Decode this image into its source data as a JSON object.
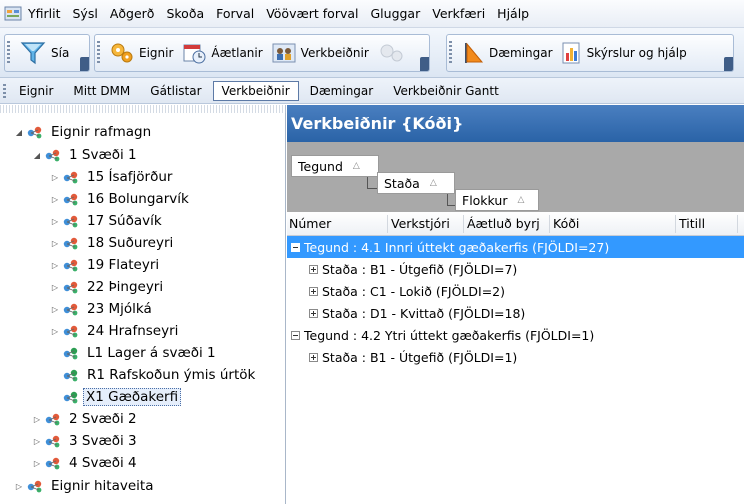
{
  "menubar": {
    "items": [
      "Yfirlit",
      "Sýsl",
      "Aðgerð",
      "Skoða",
      "Forval",
      "Vöövært forval",
      "Gluggar",
      "Verkfæri",
      "Hjálp"
    ]
  },
  "toolbar": {
    "sia": "Sía",
    "eignir": "Eignir",
    "aetlanir": "Áætlanir",
    "verkbeidnir": "Verkbeiðnir",
    "daemingar": "Dæmingar",
    "skyrslur": "Skýrslur og hjálp"
  },
  "subbar": {
    "tabs": [
      "Eignir",
      "Mitt DMM",
      "Gátlistar",
      "Verkbeiðnir",
      "Dæmingar",
      "Verkbeiðnir Gantt"
    ],
    "active": "Verkbeiðnir"
  },
  "tree": {
    "items": [
      {
        "label": "Eignir rafmagn",
        "toggle": "◢"
      },
      {
        "label": "1 Svæði 1",
        "toggle": "◢"
      },
      {
        "label": "15 Ísafjörður",
        "toggle": "▷"
      },
      {
        "label": "16 Bolungarvík",
        "toggle": "▷"
      },
      {
        "label": "17 Súðavík",
        "toggle": "▷"
      },
      {
        "label": "18 Suðureyri",
        "toggle": "▷"
      },
      {
        "label": "19 Flateyri",
        "toggle": "▷"
      },
      {
        "label": "22 Þingeyri",
        "toggle": "▷"
      },
      {
        "label": "23 Mjólká",
        "toggle": "▷"
      },
      {
        "label": "24 Hrafnseyri",
        "toggle": "▷"
      },
      {
        "label": "L1 Lager á svæði 1",
        "toggle": ""
      },
      {
        "label": "R1 Rafskoðun ýmis úrtök",
        "toggle": ""
      },
      {
        "label": "X1 Gæðakerfi",
        "toggle": ""
      },
      {
        "label": "2 Svæði 2",
        "toggle": "▷"
      },
      {
        "label": "3 Svæði 3",
        "toggle": "▷"
      },
      {
        "label": "4 Svæði 4",
        "toggle": "▷"
      },
      {
        "label": "Eignir hitaveita",
        "toggle": "▷"
      }
    ],
    "selected": "X1 Gæðakerfi"
  },
  "rightpane": {
    "title": "Verkbeiðnir {Kóði}",
    "group_chips": [
      "Tegund",
      "Staða",
      "Flokkur"
    ],
    "columns": [
      "Númer",
      "Verkstjóri",
      "Áætluð byrj",
      "Kóði",
      "Titill"
    ],
    "rows": [
      {
        "text": "Tegund : 4.1 Innri úttekt gæðakerfis (FJÖLDI=27)",
        "level": 1,
        "expanded": true,
        "selected": true
      },
      {
        "text": "Staða : B1 - Útgefið (FJÖLDI=7)",
        "level": 2,
        "expanded": false,
        "selected": false
      },
      {
        "text": "Staða : C1 - Lokið (FJÖLDI=2)",
        "level": 2,
        "expanded": false,
        "selected": false
      },
      {
        "text": "Staða : D1 - Kvittað (FJÖLDI=18)",
        "level": 2,
        "expanded": false,
        "selected": false
      },
      {
        "text": "Tegund : 4.2 Ytri úttekt gæðakerfis (FJÖLDI=1)",
        "level": 1,
        "expanded": true,
        "selected": false
      },
      {
        "text": "Staða : B1 - Útgefið (FJÖLDI=1)",
        "level": 2,
        "expanded": false,
        "selected": false
      }
    ]
  },
  "colors": {
    "title_bar": "#2a63a7",
    "selection": "#3399ff",
    "group_area": "#a9a9a9"
  }
}
